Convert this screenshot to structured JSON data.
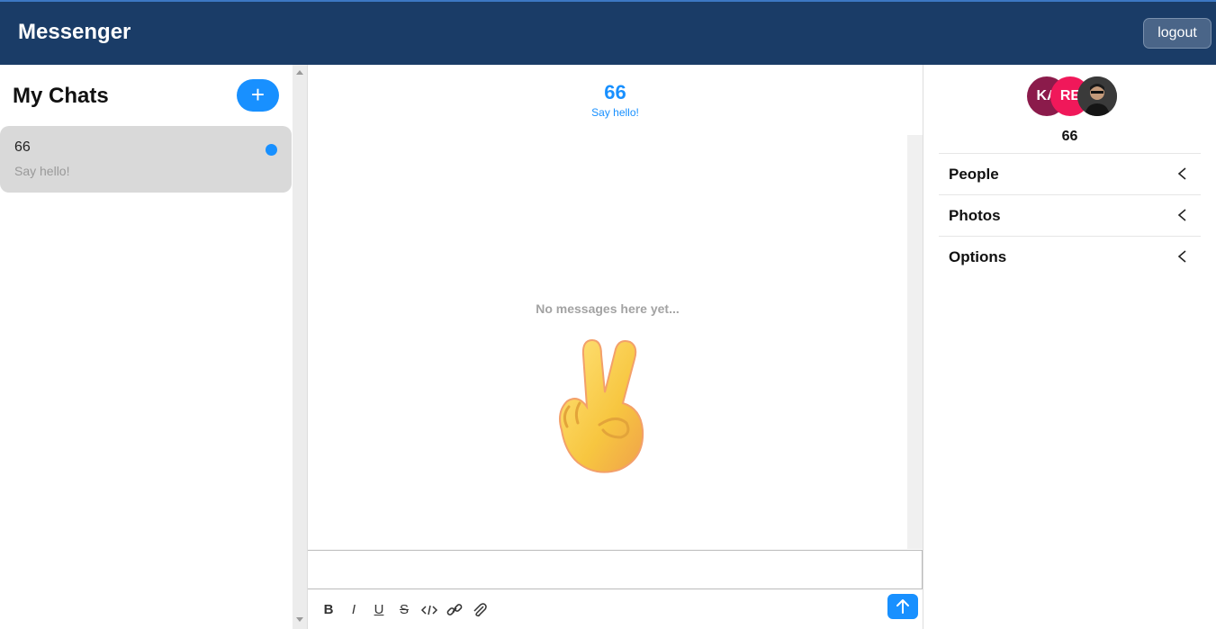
{
  "header": {
    "brand": "Messenger",
    "logout_label": "logout"
  },
  "sidebar": {
    "title": "My Chats",
    "new_chat_label": "+",
    "chats": [
      {
        "name": "66",
        "preview": "Say hello!",
        "unread": true
      }
    ]
  },
  "chat": {
    "title": "66",
    "subtitle": "Say hello!",
    "empty_text": "No messages here yet...",
    "empty_icon": "peace-hand-icon",
    "toolbar_icons": [
      "bold-icon",
      "italic-icon",
      "underline-icon",
      "strikethrough-icon",
      "code-icon",
      "link-icon",
      "attachment-icon"
    ],
    "toolbar_glyphs": {
      "bold": "B",
      "italic": "I",
      "underline": "U",
      "strike": "S"
    },
    "send_icon": "arrow-up-icon"
  },
  "details": {
    "avatars": [
      {
        "initials": "KA",
        "color": "#8b1b4b"
      },
      {
        "initials": "RE",
        "color": "#f0185a"
      },
      {
        "initials": "",
        "color": "#2a2a2a"
      }
    ],
    "chat_name": "66",
    "sections": [
      {
        "label": "People"
      },
      {
        "label": "Photos"
      },
      {
        "label": "Options"
      }
    ]
  },
  "colors": {
    "header_bg": "#1a3c67",
    "accent": "#1890ff",
    "card_bg": "#d9d9d9"
  }
}
